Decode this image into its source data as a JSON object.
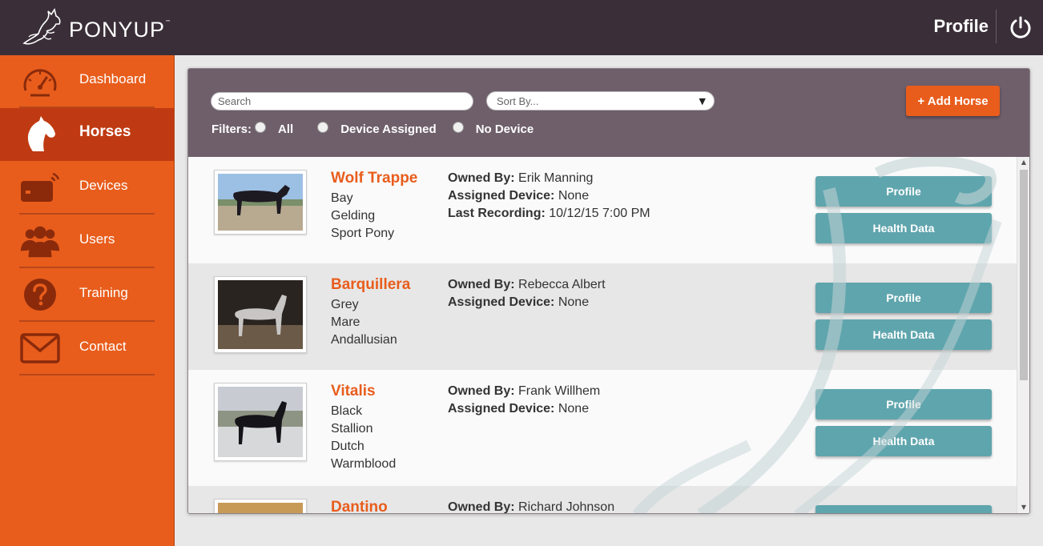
{
  "app": {
    "logo_text": "PONYUP",
    "logo_tm": "™"
  },
  "header": {
    "title": "Profile"
  },
  "sidebar": {
    "items": [
      {
        "label": "Dashboard"
      },
      {
        "label": "Horses"
      },
      {
        "label": "Devices"
      },
      {
        "label": "Users"
      },
      {
        "label": "Training"
      },
      {
        "label": "Contact"
      }
    ],
    "active": "Horses"
  },
  "toolbar": {
    "search_placeholder": "Search",
    "sort_placeholder": "Sort By...",
    "filters_label": "Filters:",
    "filter_options": [
      "All",
      "Device Assigned",
      "No Device"
    ],
    "add_horse_label": "+ Add Horse"
  },
  "labels": {
    "owned_by": "Owned By:",
    "assigned_device": "Assigned Device:",
    "last_recording": "Last Recording:",
    "profile_button": "Profile",
    "health_button": "Health Data"
  },
  "horses": [
    {
      "name": "Wolf Trappe",
      "attributes": [
        "Bay",
        "Gelding",
        "Sport Pony"
      ],
      "owner": "Erik Manning",
      "device": "None",
      "last_recording": "10/12/15 7:00 PM"
    },
    {
      "name": "Barquillera",
      "attributes": [
        "Grey",
        "Mare",
        "Andallusian"
      ],
      "owner": "Rebecca Albert",
      "device": "None"
    },
    {
      "name": "Vitalis",
      "attributes": [
        "Black",
        "Stallion",
        "Dutch",
        "Warmblood"
      ],
      "owner": "Frank Willhem",
      "device": "None"
    },
    {
      "name": "Dantino",
      "owner": "Richard Johnson"
    }
  ],
  "colors": {
    "header_bg": "#3a2f38",
    "sidebar_bg": "#e85d1c",
    "sidebar_active": "#bf3a12",
    "panel_head": "#6e5f6b",
    "teal_button": "#5fa5ad",
    "accent": "#e85d1c"
  },
  "icons": [
    "pony-logo",
    "power-icon",
    "gauge-icon",
    "horse-head-icon",
    "device-icon",
    "users-icon",
    "question-icon",
    "mail-icon",
    "chevron-down-icon"
  ]
}
